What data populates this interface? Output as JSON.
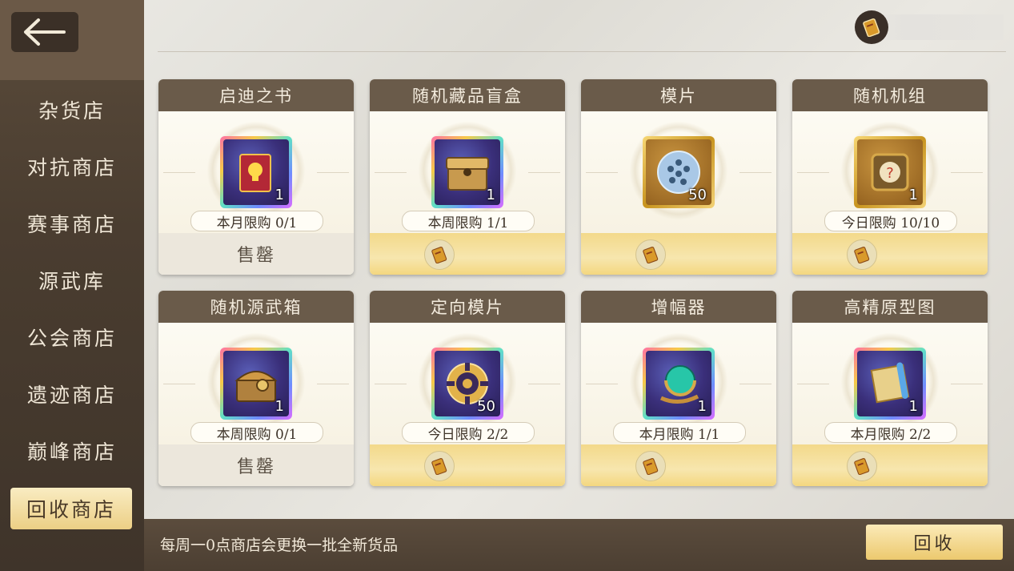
{
  "header": {
    "back_icon": "arrow-left-icon",
    "currency_icon": "ticket-icon"
  },
  "sidebar": {
    "items": [
      {
        "label": "杂货店",
        "active": false
      },
      {
        "label": "对抗商店",
        "active": false
      },
      {
        "label": "赛事商店",
        "active": false
      },
      {
        "label": "源武库",
        "active": false
      },
      {
        "label": "公会商店",
        "active": false
      },
      {
        "label": "遗迹商店",
        "active": false
      },
      {
        "label": "巅峰商店",
        "active": false
      },
      {
        "label": "回收商店",
        "active": true
      }
    ]
  },
  "cards": [
    {
      "title": "启迪之书",
      "icon": "red-book-icon",
      "qty": "1",
      "limit": "本月限购 0/1",
      "sold_out": true,
      "sold_label": "售罄"
    },
    {
      "title": "随机藏品盲盒",
      "icon": "mystery-box-icon",
      "qty": "1",
      "limit": "本周限购 1/1",
      "sold_out": false,
      "sold_label": ""
    },
    {
      "title": "模片",
      "icon": "disc-chip-icon",
      "qty": "50",
      "limit": "",
      "sold_out": false,
      "sold_label": ""
    },
    {
      "title": "随机机组",
      "icon": "mystery-device-icon",
      "qty": "1",
      "limit": "今日限购 10/10",
      "sold_out": false,
      "sold_label": ""
    },
    {
      "title": "随机源武箱",
      "icon": "treasure-chest-icon",
      "qty": "1",
      "limit": "本周限购 0/1",
      "sold_out": true,
      "sold_label": "售罄"
    },
    {
      "title": "定向模片",
      "icon": "target-chip-icon",
      "qty": "50",
      "limit": "今日限购 2/2",
      "sold_out": false,
      "sold_label": ""
    },
    {
      "title": "增幅器",
      "icon": "amplifier-orb-icon",
      "qty": "1",
      "limit": "本月限购 1/1",
      "sold_out": false,
      "sold_label": ""
    },
    {
      "title": "高精原型图",
      "icon": "blueprint-scroll-icon",
      "qty": "1",
      "limit": "本月限购 2/2",
      "sold_out": false,
      "sold_label": ""
    }
  ],
  "footer": {
    "notice": "每周一0点商店会更换一批全新货品",
    "recycle_label": "回收"
  }
}
